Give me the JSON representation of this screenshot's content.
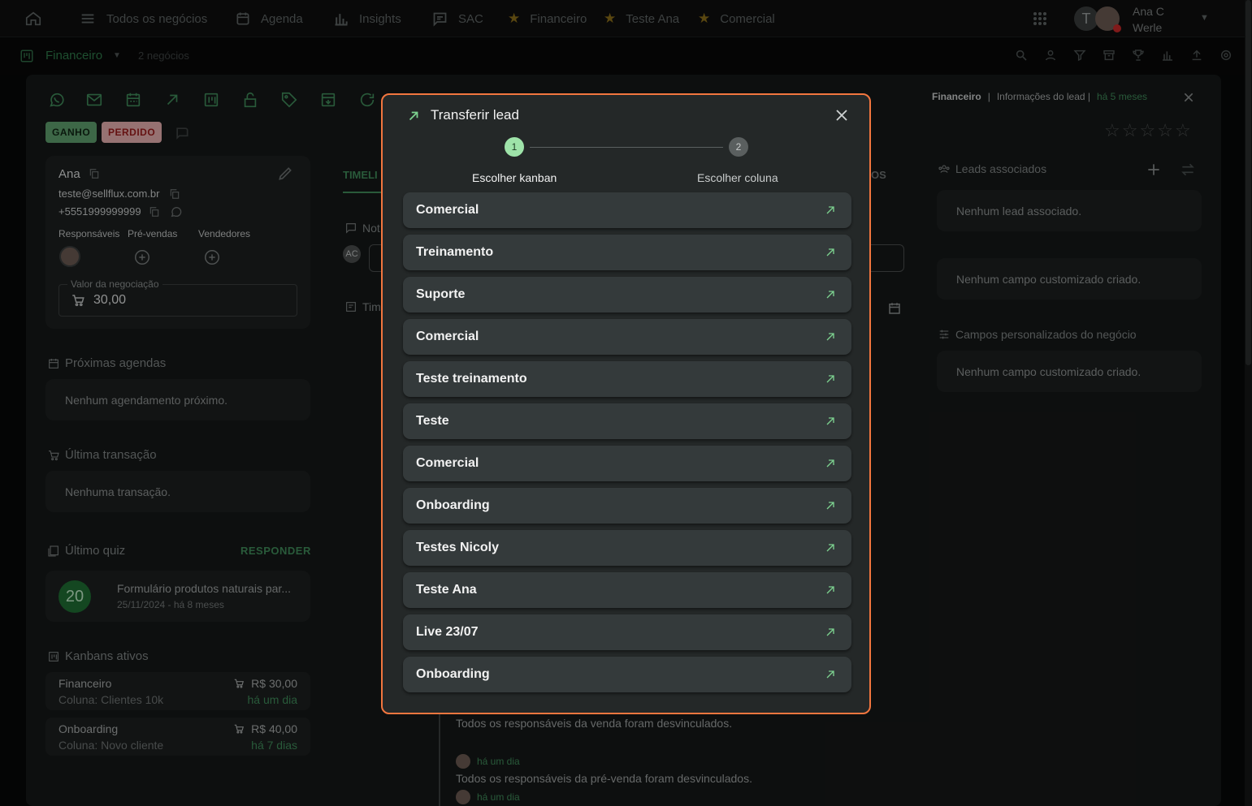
{
  "topnav": {
    "home_icon": "home-icon",
    "items": [
      {
        "label": "Todos os negócios",
        "icon": "menu-icon"
      },
      {
        "label": "Agenda",
        "icon": "calendar-icon"
      },
      {
        "label": "Insights",
        "icon": "bar-chart-icon"
      },
      {
        "label": "SAC",
        "icon": "chat-icon"
      },
      {
        "label": "Financeiro",
        "icon": "star-icon"
      },
      {
        "label": "Teste Ana",
        "icon": "star-icon"
      },
      {
        "label": "Comercial",
        "icon": "star-icon"
      }
    ],
    "user": {
      "initial": "T",
      "name_line1": "Ana C",
      "name_line2": "Werle"
    }
  },
  "subbar": {
    "kanban": "Financeiro",
    "count": "2 negócios"
  },
  "lead": {
    "tag_won": "GANHO",
    "tag_lost": "PERDIDO",
    "name": "Ana",
    "email": "teste@sellflux.com.br",
    "phone": "+5551999999999",
    "roles": {
      "responsaveis": "Responsáveis",
      "pre_vendas": "Pré-vendas",
      "vendedores": "Vendedores"
    },
    "value_label": "Valor da negociação",
    "value": "30,00"
  },
  "sections": {
    "agendas_title": "Próximas agendas",
    "agendas_empty": "Nenhum agendamento próximo.",
    "transacao_title": "Última transação",
    "transacao_empty": "Nenhuma transação.",
    "quiz_title": "Último quiz",
    "quiz_action": "RESPONDER",
    "quiz_score": "20",
    "quiz_name": "Formulário produtos naturais par...",
    "quiz_date": "25/11/2024 - há 8 meses",
    "kanbans_title": "Kanbans ativos",
    "kanbans": [
      {
        "name": "Financeiro",
        "column": "Coluna: Clientes 10k",
        "value": "R$ 30,00",
        "time": "há um dia"
      },
      {
        "name": "Onboarding",
        "column": "Coluna: Novo cliente",
        "value": "R$ 40,00",
        "time": "há 7 dias"
      }
    ]
  },
  "middle": {
    "tab": "TIMELI",
    "tab_right": "OS",
    "notes": "Not",
    "avatar": "AC",
    "timeline": "Tim",
    "events": [
      {
        "text": "Todos os responsáveis da venda foram desvinculados.",
        "time": "há um dia"
      },
      {
        "text": "Todos os responsáveis da pré-venda foram desvinculados.",
        "time": "há um dia"
      }
    ]
  },
  "right": {
    "crumb_kanban": "Financeiro",
    "crumb_sep": "|",
    "crumb_info": "Informações do lead |",
    "crumb_time": "há 5 meses",
    "leads_title": "Leads associados",
    "leads_empty": "Nenhum lead associado.",
    "custom_empty": "Nenhum campo customizado criado.",
    "fields_title": "Campos personalizados do negócio",
    "fields_empty": "Nenhum campo customizado criado."
  },
  "modal": {
    "title": "Transferir lead",
    "step1_num": "1",
    "step1_label": "Escolher kanban",
    "step2_num": "2",
    "step2_label": "Escolher coluna",
    "kanbans": [
      "Comercial",
      "Treinamento",
      "Suporte",
      "Comercial",
      "Teste treinamento",
      "Teste",
      "Comercial",
      "Onboarding",
      "Testes Nicoly",
      "Teste Ana",
      "Live 23/07",
      "Onboarding"
    ]
  },
  "colors": {
    "accent": "#f2763f",
    "green": "#3f8b5a",
    "step_active": "#7cd18f"
  }
}
